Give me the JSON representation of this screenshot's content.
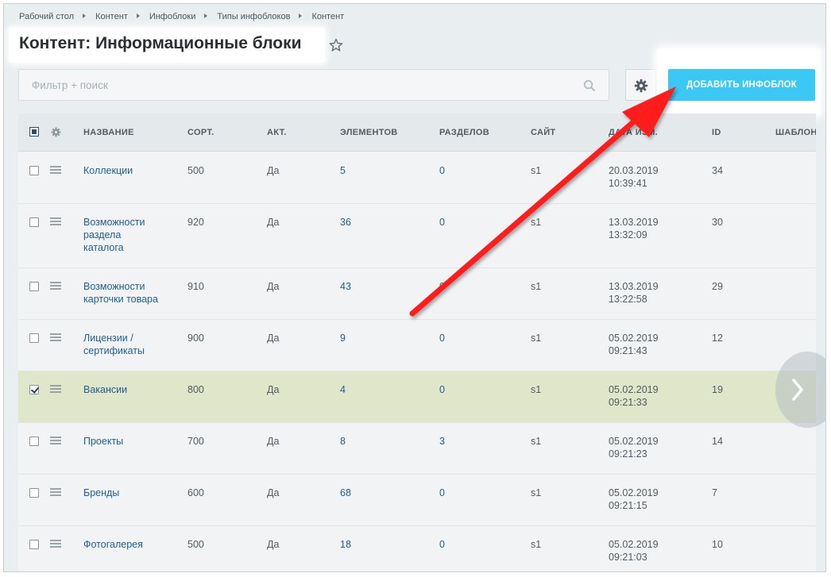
{
  "breadcrumbs": [
    "Рабочий стол",
    "Контент",
    "Инфоблоки",
    "Типы инфоблоков",
    "Контент"
  ],
  "page_title": "Контент: Информационные блоки",
  "filter": {
    "placeholder": "Фильтр + поиск"
  },
  "add_button_label": "ДОБАВИТЬ ИНФОБЛОК",
  "colors": {
    "accent": "#3bc8f5",
    "link": "#1f5f93",
    "selected_row": "#dfe6c9",
    "arrow": "#ff1a1a"
  },
  "columns": [
    "НАЗВАНИЕ",
    "СОРТ.",
    "АКТ.",
    "ЭЛЕМЕНТОВ",
    "РАЗДЕЛОВ",
    "САЙТ",
    "ДАТА ИЗМ.",
    "ID",
    "ШАБЛОН"
  ],
  "rows": [
    {
      "name": [
        "Коллекции"
      ],
      "sort": "500",
      "active": "Да",
      "elements": "5",
      "sections": "0",
      "site": "s1",
      "date": "20.03.2019",
      "time": "10:39:41",
      "id": "34",
      "checked": false
    },
    {
      "name": [
        "Возможности",
        "раздела",
        "каталога"
      ],
      "sort": "920",
      "active": "Да",
      "elements": "36",
      "sections": "0",
      "site": "s1",
      "date": "13.03.2019",
      "time": "13:32:09",
      "id": "30",
      "checked": false
    },
    {
      "name": [
        "Возможности",
        "карточки товара"
      ],
      "sort": "910",
      "active": "Да",
      "elements": "43",
      "sections": "0",
      "site": "s1",
      "date": "13.03.2019",
      "time": "13:22:58",
      "id": "29",
      "checked": false
    },
    {
      "name": [
        "Лицензии /",
        "сертификаты"
      ],
      "sort": "900",
      "active": "Да",
      "elements": "9",
      "sections": "0",
      "site": "s1",
      "date": "05.02.2019",
      "time": "09:21:43",
      "id": "12",
      "checked": false
    },
    {
      "name": [
        "Вакансии"
      ],
      "sort": "800",
      "active": "Да",
      "elements": "4",
      "sections": "0",
      "site": "s1",
      "date": "05.02.2019",
      "time": "09:21:33",
      "id": "19",
      "checked": true
    },
    {
      "name": [
        "Проекты"
      ],
      "sort": "700",
      "active": "Да",
      "elements": "8",
      "sections": "3",
      "site": "s1",
      "date": "05.02.2019",
      "time": "09:21:23",
      "id": "14",
      "checked": false
    },
    {
      "name": [
        "Бренды"
      ],
      "sort": "600",
      "active": "Да",
      "elements": "68",
      "sections": "0",
      "site": "s1",
      "date": "05.02.2019",
      "time": "09:21:15",
      "id": "7",
      "checked": false
    },
    {
      "name": [
        "Фотогалерея"
      ],
      "sort": "500",
      "active": "Да",
      "elements": "18",
      "sections": "0",
      "site": "s1",
      "date": "05.02.2019",
      "time": "09:21:03",
      "id": "10",
      "checked": false
    }
  ]
}
